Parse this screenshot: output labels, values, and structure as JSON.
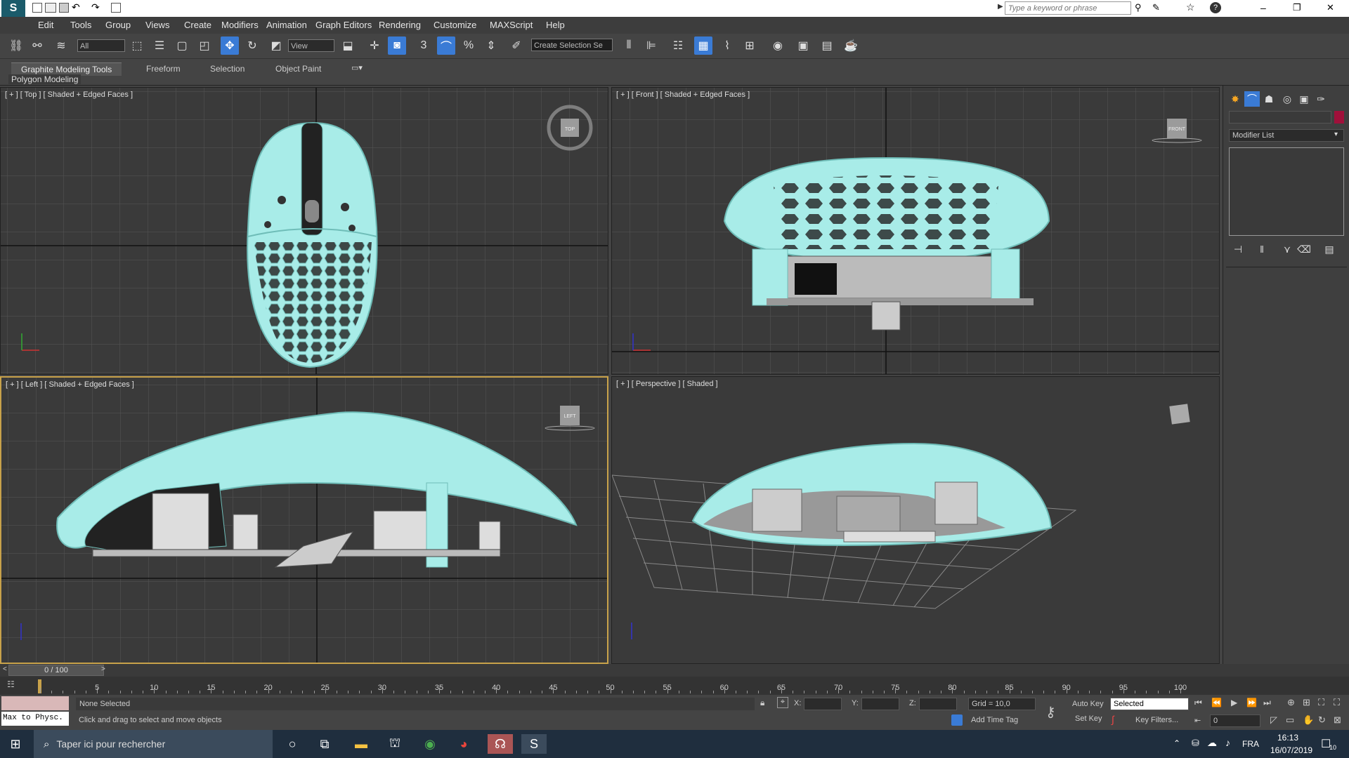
{
  "titlebar": {
    "search_placeholder": "Type a keyword or phrase",
    "minimize": "–",
    "maximize": "❐",
    "close": "✕"
  },
  "menu": {
    "items": [
      "Edit",
      "Tools",
      "Group",
      "Views",
      "Create",
      "Modifiers",
      "Animation",
      "Graph Editors",
      "Rendering",
      "Customize",
      "MAXScript",
      "Help"
    ]
  },
  "toolbar": {
    "selection_filter": "All",
    "reference_coord": "View",
    "named_selection": "Create Selection Se",
    "snap_3d": "3",
    "percent_snap": "%"
  },
  "ribbon": {
    "tabs": [
      "Graphite Modeling Tools",
      "Freeform",
      "Selection",
      "Object Paint"
    ],
    "sub_label": "Polygon Modeling"
  },
  "viewports": {
    "top": {
      "label": "[ + ] [ Top ] [ Shaded + Edged Faces ]",
      "cube": "TOP"
    },
    "front": {
      "label": "[ + ] [ Front ] [ Shaded + Edged Faces ]",
      "cube": "FRONT"
    },
    "left": {
      "label": "[ + ] [ Left ] [ Shaded + Edged Faces ]",
      "cube": "LEFT"
    },
    "perspective": {
      "label": "[ + ] [ Perspective ] [ Shaded ]"
    }
  },
  "command_panel": {
    "modifier_list": "Modifier List",
    "color_swatch": "#a0103a"
  },
  "timeline": {
    "frame_display": "0 / 100",
    "ticks": [
      "5",
      "10",
      "15",
      "20",
      "25",
      "30",
      "35",
      "40",
      "45",
      "50",
      "55",
      "60",
      "65",
      "70",
      "75",
      "80",
      "85",
      "90",
      "95",
      "100"
    ]
  },
  "status": {
    "script_listener": "Max to Physc.",
    "selection": "None Selected",
    "prompt": "Click and drag to select and move objects",
    "x_label": "X:",
    "y_label": "Y:",
    "z_label": "Z:",
    "grid": "Grid = 10,0",
    "add_time_tag": "Add Time Tag",
    "auto_key": "Auto Key",
    "set_key": "Set Key",
    "selected": "Selected",
    "key_filters": "Key Filters...",
    "frame": "0"
  },
  "taskbar": {
    "search_placeholder": "Taper ici pour rechercher",
    "language": "FRA",
    "time": "16:13",
    "date": "16/07/2019",
    "notifications": "10"
  },
  "colors": {
    "mesh": "#a8ece8",
    "mesh_dark": "#6fbdb8",
    "accent": "#3a7bd5",
    "active_viewport": "#c8a24a"
  }
}
